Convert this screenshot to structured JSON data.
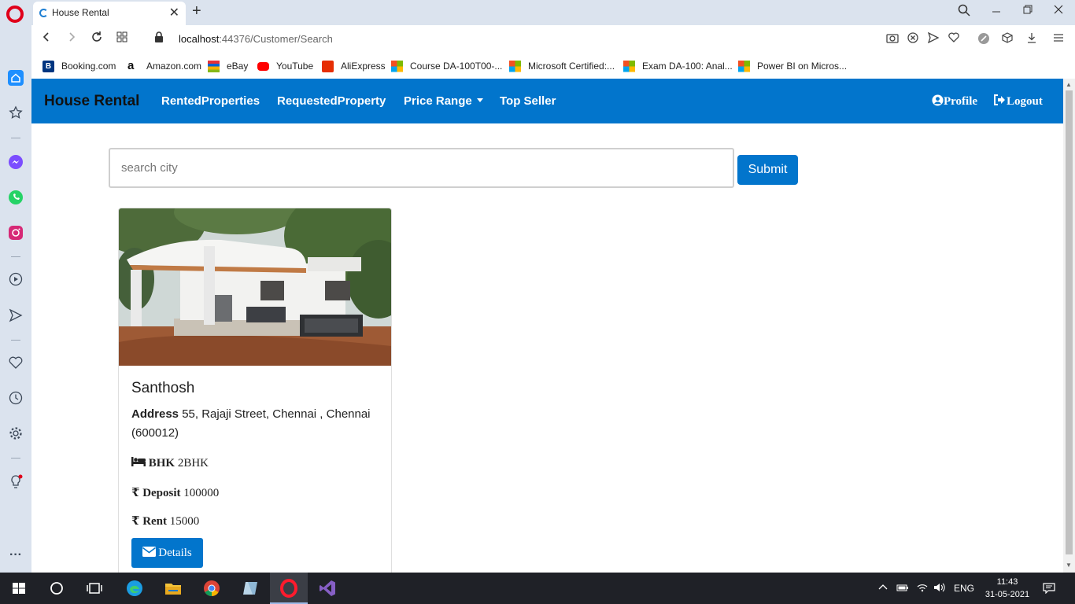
{
  "browser": {
    "tab_title": "House Rental",
    "url_host": "localhost",
    "url_rest": ":44376/Customer/Search",
    "tab_close": "✕",
    "new_tab": "+"
  },
  "bookmarks": [
    {
      "label": "Booking.com",
      "icon": "booking-icon"
    },
    {
      "label": "Amazon.com",
      "icon": "amazon-icon"
    },
    {
      "label": "eBay",
      "icon": "ebay-icon"
    },
    {
      "label": "YouTube",
      "icon": "youtube-icon"
    },
    {
      "label": "AliExpress",
      "icon": "aliexpress-icon"
    },
    {
      "label": "Course DA-100T00-...",
      "icon": "microsoft-icon"
    },
    {
      "label": "Microsoft Certified:...",
      "icon": "microsoft-icon"
    },
    {
      "label": "Exam DA-100: Anal...",
      "icon": "microsoft-icon"
    },
    {
      "label": "Power BI on Micros...",
      "icon": "microsoft-icon"
    }
  ],
  "navbar": {
    "brand": "House Rental",
    "links": [
      "RentedProperties",
      "RequestedProperty",
      "Price Range",
      "Top Seller"
    ],
    "profile": "Profile",
    "logout": "Logout"
  },
  "search": {
    "placeholder": "search city",
    "submit_label": "Submit"
  },
  "card": {
    "name": "Santhosh",
    "address_label": "Address",
    "address_value": "55, Rajaji Street, Chennai , Chennai (600012)",
    "bhk_label": "BHK",
    "bhk_value": "2BHK",
    "deposit_label": "Deposit",
    "deposit_value": "100000",
    "rent_label": "Rent",
    "rent_value": "15000",
    "details_label": "Details"
  },
  "taskbar": {
    "lang": "ENG",
    "time": "11:43",
    "date": "31-05-2021"
  },
  "colors": {
    "primary": "#0275cc",
    "opera_red": "#e0001a"
  }
}
